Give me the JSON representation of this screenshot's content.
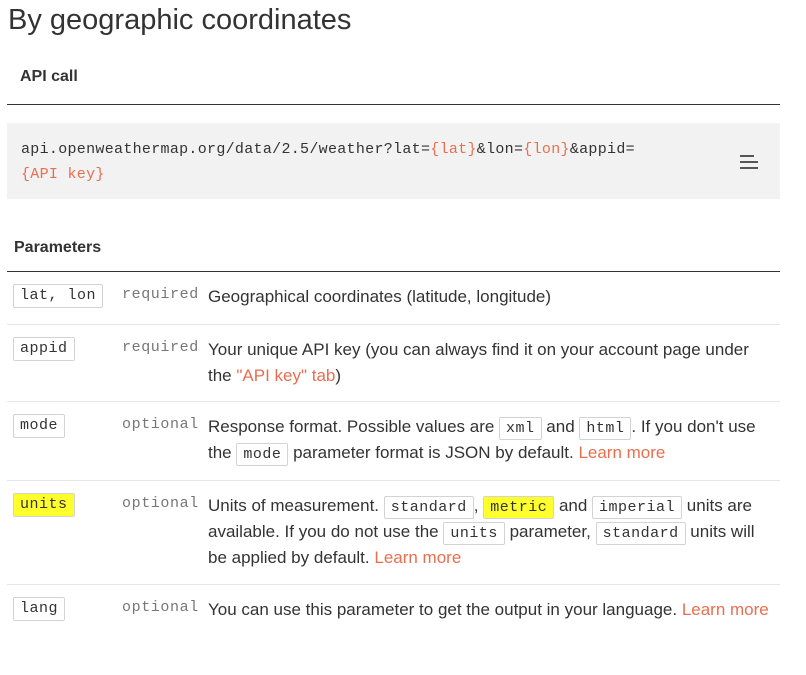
{
  "page_title": "By geographic coordinates",
  "api_call": {
    "heading": "API call",
    "url_prefix": "api.openweathermap.org/data/2.5/weather?lat=",
    "lat_ph": "{lat}",
    "lon_sep": "&lon=",
    "lon_ph": "{lon}",
    "appid_sep": "&appid=",
    "key_ph": "{API key}",
    "menu_icon": "hamburger-menu-icon"
  },
  "parameters": {
    "heading": "Parameters",
    "rows": [
      {
        "name": "lat, lon",
        "status": "required",
        "description": "Geographical coordinates (latitude, longitude)"
      },
      {
        "name": "appid",
        "status": "required",
        "description": "Your unique API key (you can always find it on your account page under the ",
        "link": "\"API key\" tab",
        "description_end": ")"
      },
      {
        "name": "mode",
        "status": "optional",
        "d1": "Response format. Possible values are ",
        "c1": "xml",
        "d2": " and ",
        "c2": "html",
        "d3": ". If you don't use the ",
        "c3": "mode",
        "d4": " parameter format is JSON by default. ",
        "link": "Learn more"
      },
      {
        "name": "units",
        "status": "optional",
        "d1": "Units of measurement. ",
        "c1": "standard",
        "d2": ", ",
        "c2": "metric",
        "d3": " and ",
        "c3": "imperial",
        "d4": " units are available. If you do not use the ",
        "c4": "units",
        "d5": " parameter, ",
        "c5": "standard",
        "d6": " units will be applied by default. ",
        "link": "Learn more",
        "highlight_color": "#ffff2e"
      },
      {
        "name": "lang",
        "status": "optional",
        "description": "You can use this parameter to get the output in your language. ",
        "link": "Learn more"
      }
    ]
  },
  "colors": {
    "link": "#e96e50",
    "text": "#333333",
    "code_block_bg": "#f2f2f2",
    "highlight": "#ffff2e"
  }
}
